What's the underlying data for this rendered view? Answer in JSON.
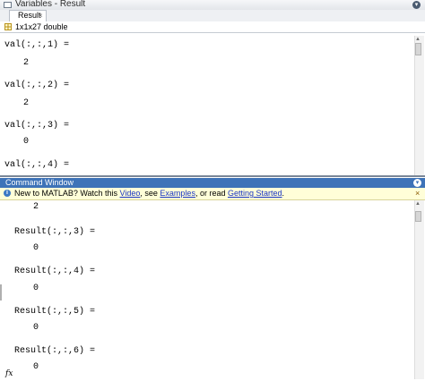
{
  "variables_panel": {
    "title": "Variables - Result",
    "tab_label": "Result",
    "tab_close": "×",
    "size_label": "1x1x27 double",
    "collapse_glyph": "▾",
    "lines": [
      "val(:,:,1) =",
      "2",
      "val(:,:,2) =",
      "2",
      "val(:,:,3) =",
      "0",
      "val(:,:,4) ="
    ]
  },
  "command_window": {
    "title": "Command Window",
    "collapse_glyph": "▾",
    "info_bar": {
      "text_1": "New to MATLAB? Watch this ",
      "link_video": "Video",
      "text_2": ", see ",
      "link_examples": "Examples",
      "text_3": ", or read ",
      "link_getting_started": "Getting Started",
      "text_4": ".",
      "close": "×"
    },
    "lines": [
      "2",
      "Result(:,:,3) =",
      "0",
      "Result(:,:,4) =",
      "0",
      "Result(:,:,5) =",
      "0",
      "Result(:,:,6) =",
      "0"
    ],
    "prompt_icon": "fx"
  },
  "scroll_up_glyph": "▲"
}
